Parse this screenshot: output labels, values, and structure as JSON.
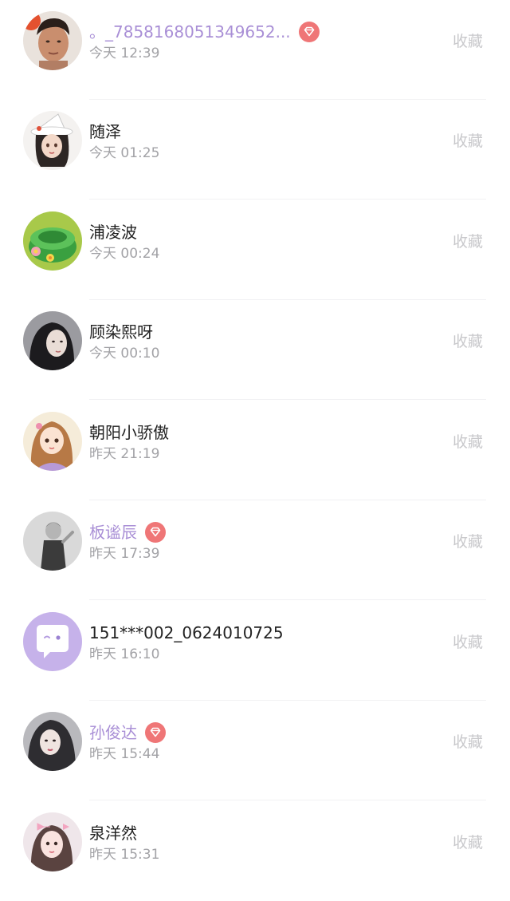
{
  "colors": {
    "vip_name": "#a98fd6",
    "normal_name": "#222222",
    "time": "#a2a2a6",
    "favorite": "#c9c9cc",
    "vip_badge": "#ef7677"
  },
  "visitors": [
    {
      "name": "。_7858168051349652...",
      "time": "今天 12:39",
      "vip": true,
      "favorite_label": "收藏",
      "avatar": "avatar-man"
    },
    {
      "name": "随泽",
      "time": "今天 01:25",
      "vip": false,
      "favorite_label": "收藏",
      "avatar": "avatar-witch-girl"
    },
    {
      "name": "浦凌波",
      "time": "今天 00:24",
      "vip": false,
      "favorite_label": "收藏",
      "avatar": "avatar-green-cake"
    },
    {
      "name": "顾染熙呀",
      "time": "今天 00:10",
      "vip": false,
      "favorite_label": "收藏",
      "avatar": "avatar-dark-girl"
    },
    {
      "name": "朝阳小骄傲",
      "time": "昨天 21:19",
      "vip": false,
      "favorite_label": "收藏",
      "avatar": "avatar-cartoon-girl"
    },
    {
      "name": "板谧辰",
      "time": "昨天 17:39",
      "vip": true,
      "favorite_label": "收藏",
      "avatar": "avatar-bw-boy"
    },
    {
      "name": "151***002_0624010725",
      "time": "昨天 16:10",
      "vip": false,
      "favorite_label": "收藏",
      "avatar": "avatar-default-chat"
    },
    {
      "name": "孙俊达",
      "time": "昨天 15:44",
      "vip": true,
      "favorite_label": "收藏",
      "avatar": "avatar-hooded-girl"
    },
    {
      "name": "泉洋然",
      "time": "昨天 15:31",
      "vip": false,
      "favorite_label": "收藏",
      "avatar": "avatar-bow-girl"
    }
  ]
}
